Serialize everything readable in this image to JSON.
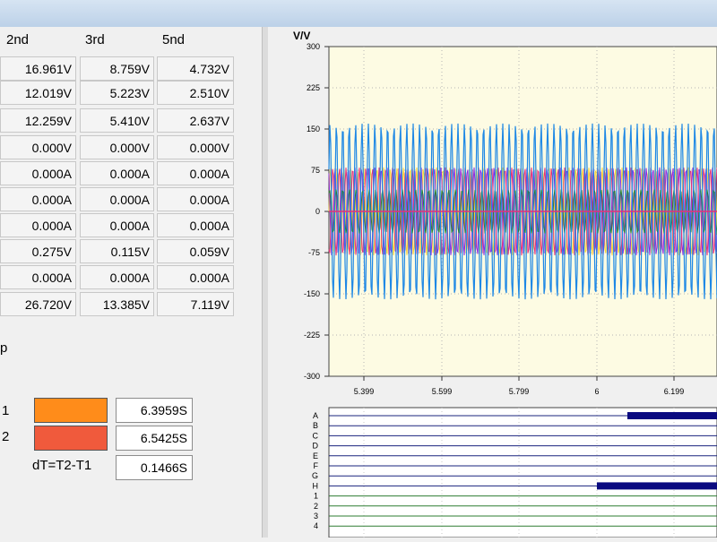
{
  "harmonics": {
    "headers": [
      "2nd",
      "3rd",
      "5nd"
    ],
    "rows": [
      [
        "16.961V",
        "8.759V",
        "4.732V"
      ],
      [
        "12.019V",
        "5.223V",
        "2.510V"
      ],
      [
        "12.259V",
        "5.410V",
        "2.637V"
      ],
      [
        "0.000V",
        "0.000V",
        "0.000V"
      ],
      [
        "0.000A",
        "0.000A",
        "0.000A"
      ],
      [
        "0.000A",
        "0.000A",
        "0.000A"
      ],
      [
        "0.000A",
        "0.000A",
        "0.000A"
      ],
      [
        "0.275V",
        "0.115V",
        "0.059V"
      ],
      [
        "0.000A",
        "0.000A",
        "0.000A"
      ],
      [
        "26.720V",
        "13.385V",
        "7.119V"
      ]
    ]
  },
  "cursor": {
    "p_label": "p",
    "t1_label": "1",
    "t1_value": "6.3959S",
    "t1_color": "#ff8c1a",
    "t2_label": "2",
    "t2_value": "6.5425S",
    "t2_color": "#f05a3c",
    "dt_label": "dT=T2-T1",
    "dt_value": "0.1466S"
  },
  "waveform": {
    "unit_label": "V/V",
    "y_ticks": [
      "300",
      "225",
      "150",
      "75",
      "0",
      "-75",
      "-150",
      "-225",
      "-300"
    ],
    "x_ticks": [
      "5.399",
      "5.599",
      "5.799",
      "6",
      "6.199"
    ],
    "colors": [
      "#1e88e5",
      "#f5d23a",
      "#8a2be2",
      "#e0327a",
      "#2e7d32"
    ]
  },
  "digital": {
    "channels": [
      "A",
      "B",
      "C",
      "D",
      "E",
      "F",
      "G",
      "H",
      "1",
      "2",
      "3",
      "4"
    ],
    "bar_color": "#0a0a80"
  }
}
